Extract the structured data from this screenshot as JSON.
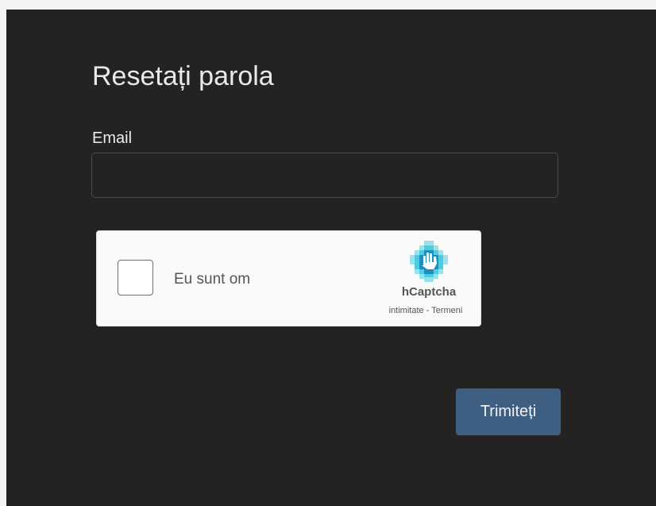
{
  "form": {
    "title": "Resetați parola",
    "email_label": "Email",
    "email_value": "",
    "email_placeholder": "",
    "submit_label": "Trimiteți"
  },
  "captcha": {
    "checkbox_label": "Eu sunt om",
    "checked": false,
    "brand": "hCaptcha",
    "link_privacy": "intimitate",
    "separator": " - ",
    "link_terms": "Termeni",
    "logo_icon": "hcaptcha-hand-icon"
  },
  "colors": {
    "background": "#232323",
    "accent_button": "#3e5f82",
    "captcha_background": "#fafafa",
    "logo_blue": "#1f8fc0",
    "logo_cyan": "#4ccde1"
  }
}
